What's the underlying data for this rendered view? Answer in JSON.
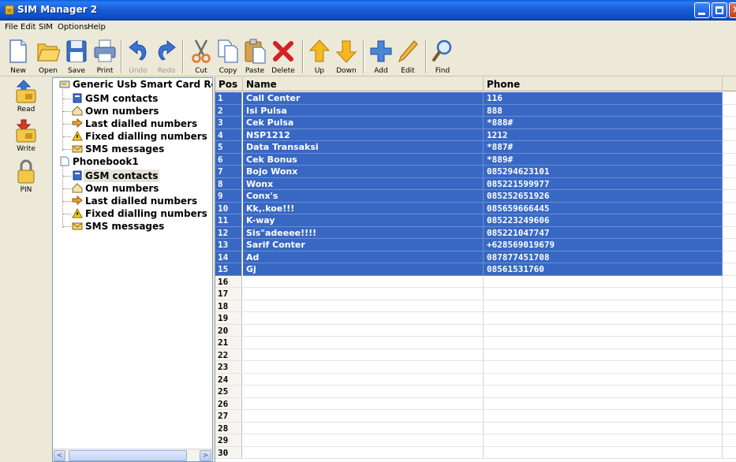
{
  "app": {
    "title": "SIM Manager 2"
  },
  "menu": [
    "File",
    "Edit",
    "SIM",
    "Options",
    "Help"
  ],
  "toolbar": [
    {
      "label": "New",
      "icon": "new-file-icon",
      "enabled": true
    },
    {
      "label": "Open",
      "icon": "folder-open-icon",
      "enabled": true
    },
    {
      "label": "Save",
      "icon": "floppy-save-icon",
      "enabled": true
    },
    {
      "label": "Print",
      "icon": "printer-icon",
      "enabled": true
    },
    {
      "label": "Undo",
      "icon": "undo-arrow-icon",
      "enabled": false
    },
    {
      "label": "Redo",
      "icon": "redo-arrow-icon",
      "enabled": false
    },
    {
      "label": "Cut",
      "icon": "scissors-icon",
      "enabled": true
    },
    {
      "label": "Copy",
      "icon": "copy-pages-icon",
      "enabled": true
    },
    {
      "label": "Paste",
      "icon": "clipboard-paste-icon",
      "enabled": true
    },
    {
      "label": "Delete",
      "icon": "red-x-delete-icon",
      "enabled": true
    },
    {
      "label": "Up",
      "icon": "arrow-up-icon",
      "enabled": true
    },
    {
      "label": "Down",
      "icon": "arrow-down-icon",
      "enabled": true
    },
    {
      "label": "Add",
      "icon": "plus-add-icon",
      "enabled": true
    },
    {
      "label": "Edit",
      "icon": "pencil-edit-icon",
      "enabled": true
    },
    {
      "label": "Find",
      "icon": "magnifier-find-icon",
      "enabled": true
    }
  ],
  "sidebar": [
    {
      "label": "Read",
      "icon": "sim-read-icon"
    },
    {
      "label": "Write",
      "icon": "sim-write-icon"
    },
    {
      "label": "PIN",
      "icon": "padlock-pin-icon"
    }
  ],
  "tree": {
    "reader": "Generic Usb Smart Card Rea",
    "reader_items": [
      "GSM contacts",
      "Own numbers",
      "Last dialled numbers",
      "Fixed dialling numbers",
      "SMS messages"
    ],
    "phonebook": "Phonebook1",
    "phonebook_items": [
      "GSM contacts",
      "Own numbers",
      "Last dialled numbers",
      "Fixed dialling numbers",
      "SMS messages"
    ],
    "selected": "Phonebook1 / GSM contacts"
  },
  "grid": {
    "headers": [
      "Pos",
      "Name",
      "Phone"
    ],
    "rows": [
      {
        "pos": "1",
        "name": "Call Center",
        "phone": "116"
      },
      {
        "pos": "2",
        "name": "Isi Pulsa",
        "phone": "888"
      },
      {
        "pos": "3",
        "name": "Cek Pulsa",
        "phone": "*888#"
      },
      {
        "pos": "4",
        "name": "NSP1212",
        "phone": "1212"
      },
      {
        "pos": "5",
        "name": "Data Transaksi",
        "phone": "*887#"
      },
      {
        "pos": "6",
        "name": "Cek Bonus",
        "phone": "*889#"
      },
      {
        "pos": "7",
        "name": "Bojo Wonx",
        "phone": "085294623101"
      },
      {
        "pos": "8",
        "name": "Wonx",
        "phone": "085221599977"
      },
      {
        "pos": "9",
        "name": "Conx's",
        "phone": "085252651926"
      },
      {
        "pos": "10",
        "name": "Kk,.koe!!!",
        "phone": "085659666445"
      },
      {
        "pos": "11",
        "name": "K-way",
        "phone": "085223249606"
      },
      {
        "pos": "12",
        "name": "Sis\"adeeee!!!!",
        "phone": "085221047747"
      },
      {
        "pos": "13",
        "name": "Sarif Conter",
        "phone": "+628569019679"
      },
      {
        "pos": "14",
        "name": "Ad",
        "phone": "087877451708"
      },
      {
        "pos": "15",
        "name": "Gj",
        "phone": "08561531760"
      },
      {
        "pos": "16",
        "name": "",
        "phone": ""
      },
      {
        "pos": "17",
        "name": "",
        "phone": ""
      },
      {
        "pos": "18",
        "name": "",
        "phone": ""
      },
      {
        "pos": "19",
        "name": "",
        "phone": ""
      },
      {
        "pos": "20",
        "name": "",
        "phone": ""
      },
      {
        "pos": "21",
        "name": "",
        "phone": ""
      },
      {
        "pos": "22",
        "name": "",
        "phone": ""
      },
      {
        "pos": "23",
        "name": "",
        "phone": ""
      },
      {
        "pos": "24",
        "name": "",
        "phone": ""
      },
      {
        "pos": "25",
        "name": "",
        "phone": ""
      },
      {
        "pos": "26",
        "name": "",
        "phone": ""
      },
      {
        "pos": "27",
        "name": "",
        "phone": ""
      },
      {
        "pos": "28",
        "name": "",
        "phone": ""
      },
      {
        "pos": "29",
        "name": "",
        "phone": ""
      },
      {
        "pos": "30",
        "name": "",
        "phone": ""
      }
    ],
    "selected_count": 15
  },
  "colors": {
    "selection": "#3868c4",
    "titlebar": "#1a5ed8",
    "chrome": "#ece9d8"
  }
}
